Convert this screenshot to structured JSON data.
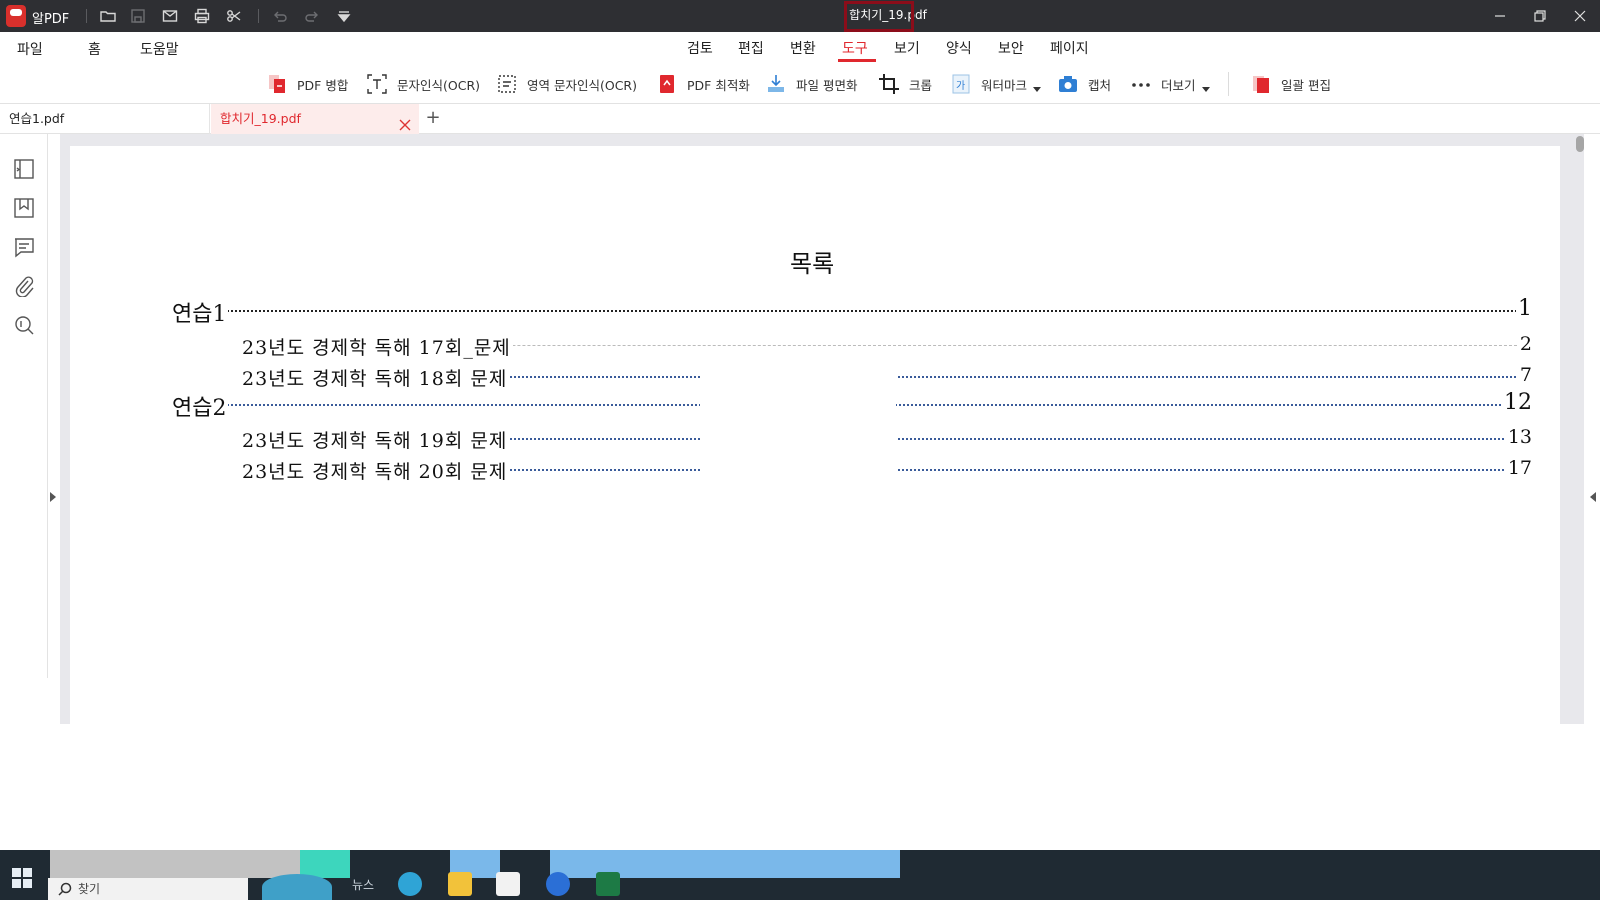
{
  "titlebar": {
    "app_name": "알PDF",
    "window_title": "합치기_19.pdf"
  },
  "menu": {
    "left": [
      "파일",
      "홈",
      "도움말"
    ],
    "tabs": [
      "검토",
      "편집",
      "변환",
      "도구",
      "보기",
      "양식",
      "보안",
      "페이지"
    ],
    "active_tab": "도구"
  },
  "toolbar": {
    "merge": "PDF 병합",
    "ocr": "문자인식(OCR)",
    "region_ocr": "영역 문자인식(OCR)",
    "optimize": "PDF 최적화",
    "flatten": "파일 평면화",
    "crop": "크롭",
    "watermark": "워터마크",
    "capture": "캡처",
    "more": "더보기",
    "batch_edit": "일괄 편집"
  },
  "doc_tabs": {
    "tab1": "연습1.pdf",
    "tab2": "합치기_19.pdf",
    "add": "+"
  },
  "toc": {
    "title": "목록",
    "entries": [
      {
        "label": "연습1",
        "page": "1"
      },
      {
        "label": "23년도 경제학 독해 17회_문제",
        "page": "2"
      },
      {
        "label": "23년도 경제학 독해 18회 문제",
        "page": "7"
      },
      {
        "label": "연습2",
        "page": "12"
      },
      {
        "label": "23년도 경제학 독해 19회 문제",
        "page": "13"
      },
      {
        "label": "23년도 경제학 독해 20회 문제",
        "page": "17"
      }
    ]
  },
  "taskbar": {
    "search_placeholder": "찾기",
    "widget_label": "뉴스"
  },
  "colors": {
    "accent": "#e0282e",
    "titlebar": "#2e2f33",
    "taskbar": "#1f2a33",
    "highlight_box": "#8c0d1a"
  }
}
